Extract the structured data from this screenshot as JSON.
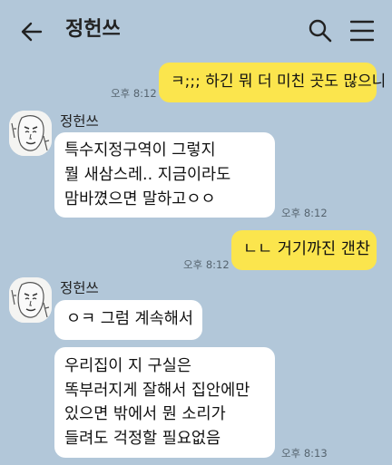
{
  "header": {
    "title": "정헌쓰"
  },
  "messages": [
    {
      "sender": "me",
      "text": "ㅋ;;; 하긴 뭐 더 미친 곳도 많으니",
      "time": "오후 8:12"
    },
    {
      "sender": "other",
      "name": "정헌쓰",
      "lines": [
        "특수지정구역이 그렇지",
        "뭘 새삼스레.. 지금이라도",
        "맘바꼈으면 말하고ㅇㅇ"
      ],
      "time": "오후 8:12"
    },
    {
      "sender": "me",
      "text": "ㄴㄴ 거기까진 갠찬",
      "time": "오후 8:12"
    },
    {
      "sender": "other",
      "name": "정헌쓰",
      "text": "ㅇㅋ 그럼 계속해서"
    },
    {
      "sender": "other",
      "lines": [
        "우리집이 지 구실은",
        "똑부러지게 잘해서 집안에만",
        "있으면 밖에서 뭔 소리가",
        "들려도 걱정할 필요없음"
      ],
      "time": "오후 8:13"
    }
  ]
}
